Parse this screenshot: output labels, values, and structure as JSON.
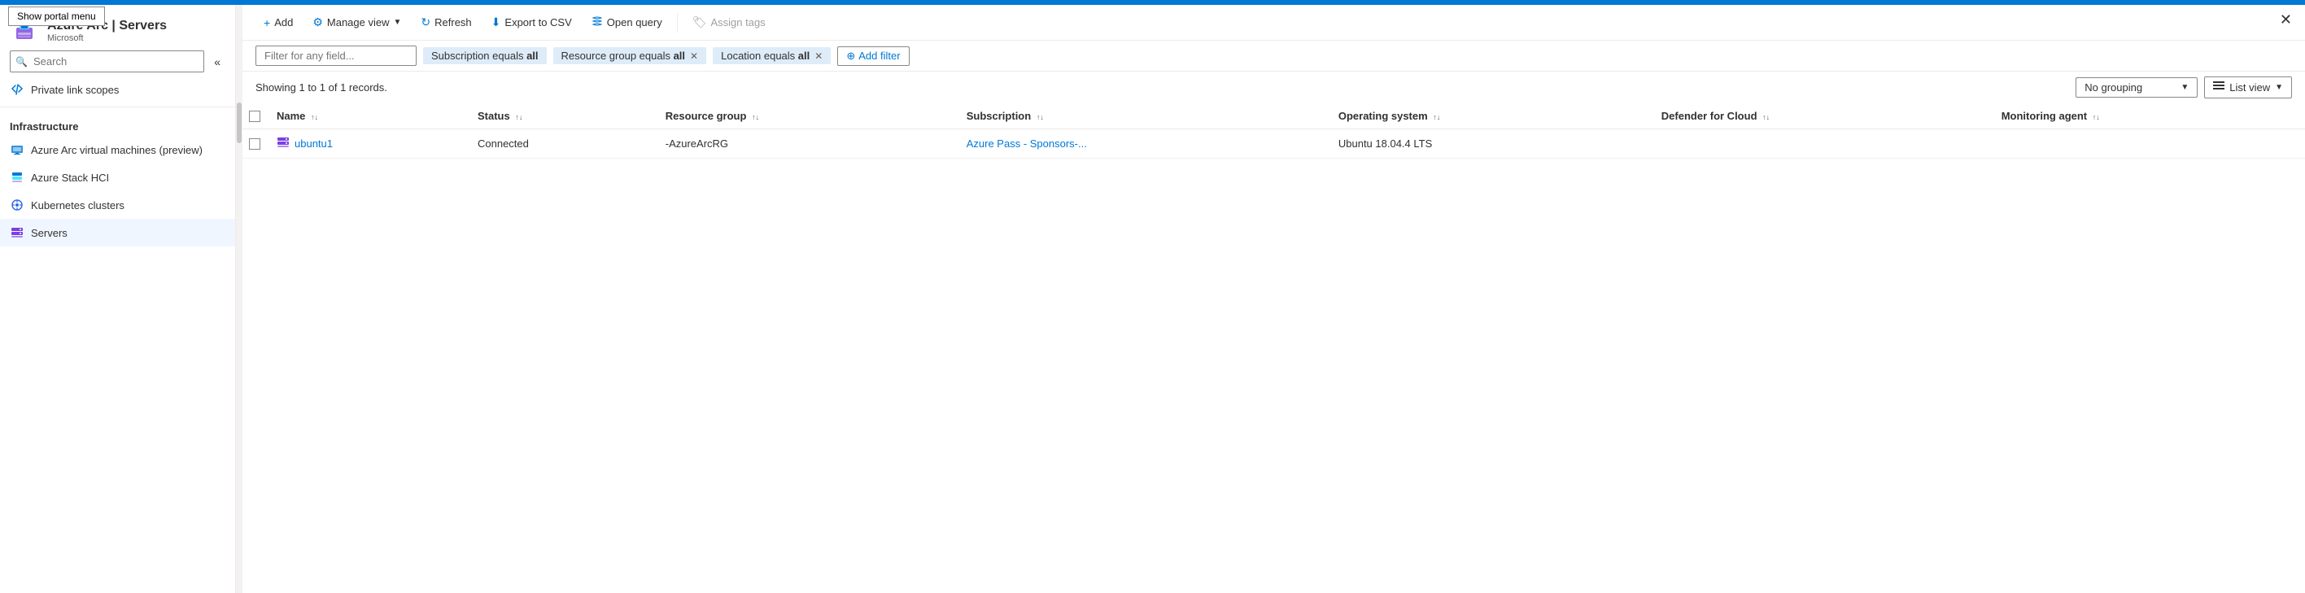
{
  "topBar": {
    "color": "#0078d4"
  },
  "portalMenu": {
    "label": "Show portal menu"
  },
  "sidebar": {
    "appName": "Azure Arc",
    "pageTitle": "Servers",
    "subtitle": "Microsoft",
    "pinIcon": "📌",
    "moreIcon": "···",
    "searchPlaceholder": "Search",
    "collapseTooltip": "Collapse sidebar",
    "navItems": [
      {
        "label": "Private link scopes",
        "icon": "link",
        "active": false,
        "section": null
      }
    ],
    "sectionHeader": "Infrastructure",
    "infraItems": [
      {
        "label": "Azure Arc virtual machines (preview)",
        "icon": "vm",
        "active": false
      },
      {
        "label": "Azure Stack HCI",
        "icon": "stack",
        "active": false
      },
      {
        "label": "Kubernetes clusters",
        "icon": "kubernetes",
        "active": false
      },
      {
        "label": "Servers",
        "icon": "servers",
        "active": true
      }
    ]
  },
  "toolbar": {
    "addLabel": "Add",
    "manageViewLabel": "Manage view",
    "refreshLabel": "Refresh",
    "exportLabel": "Export to CSV",
    "openQueryLabel": "Open query",
    "assignTagsLabel": "Assign tags"
  },
  "filters": {
    "placeholder": "Filter for any field...",
    "tags": [
      {
        "label": "Subscription equals ",
        "bold": "all",
        "removable": false
      },
      {
        "label": "Resource group equals ",
        "bold": "all",
        "removable": true
      },
      {
        "label": "Location equals ",
        "bold": "all",
        "removable": true
      }
    ],
    "addFilterLabel": "Add filter"
  },
  "resultsBar": {
    "text": "Showing 1 to 1 of 1 records.",
    "groupingLabel": "No grouping",
    "listViewLabel": "List view"
  },
  "table": {
    "columns": [
      {
        "label": "Name",
        "sortable": true
      },
      {
        "label": "Status",
        "sortable": true
      },
      {
        "label": "Resource group",
        "sortable": true
      },
      {
        "label": "Subscription",
        "sortable": true
      },
      {
        "label": "Operating system",
        "sortable": true
      },
      {
        "label": "Defender for Cloud",
        "sortable": true
      },
      {
        "label": "Monitoring agent",
        "sortable": true
      }
    ],
    "rows": [
      {
        "name": "ubuntu1",
        "status": "Connected",
        "resourceGroup": "-AzureArcRG",
        "subscription": "Azure Pass - Sponsors-...",
        "operatingSystem": "Ubuntu 18.04.4 LTS",
        "defenderForCloud": "",
        "monitoringAgent": ""
      }
    ]
  },
  "closeWindow": "✕"
}
